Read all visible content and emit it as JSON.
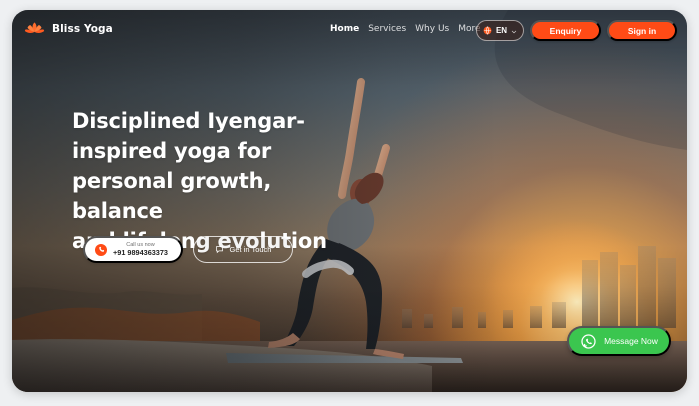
{
  "header": {
    "brand": "Bliss Yoga",
    "nav": [
      {
        "label": "Home",
        "active": true
      },
      {
        "label": "Services",
        "active": false
      },
      {
        "label": "Why Us",
        "active": false
      },
      {
        "label": "More",
        "active": false
      }
    ],
    "language": "EN",
    "enquiry_label": "Enquiry",
    "signin_label": "Sign in"
  },
  "hero": {
    "title_lines": [
      "Disciplined Iyengar-",
      "inspired yoga for",
      "personal growth, balance",
      "and lifelong evolution"
    ],
    "call_label": "Call us now",
    "call_number": "+91 9894363373",
    "contact_label": "Get in Touch"
  },
  "floating": {
    "message_label": "Message Now"
  },
  "icons": {
    "brand_logo": "lotus-icon",
    "dropdown": "chevron-down-icon",
    "language": "globe-icon",
    "phone": "phone-icon",
    "message": "message-icon",
    "whatsapp": "whatsapp-icon"
  },
  "colors": {
    "accent": "#ff4b16",
    "whatsapp": "#3bc64f",
    "text_light": "#ffffff"
  }
}
